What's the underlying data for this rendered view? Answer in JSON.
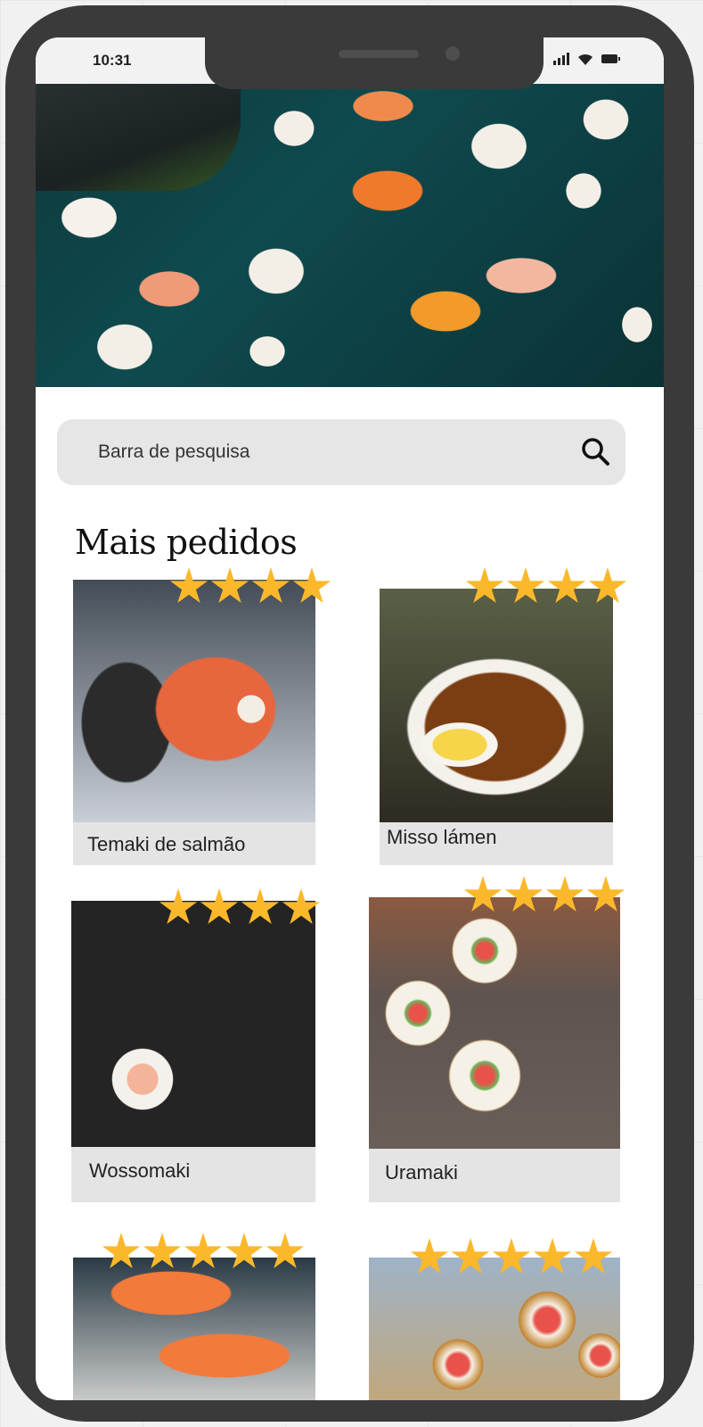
{
  "status_bar": {
    "time": "10:31"
  },
  "search": {
    "placeholder": "Barra de pesquisa",
    "icon": "search-icon"
  },
  "section": {
    "title": "Mais pedidos"
  },
  "items": [
    {
      "label": "Temaki de salmão",
      "rating": 4,
      "max_rating": 4
    },
    {
      "label": "Misso lámen",
      "rating": 4,
      "max_rating": 4
    },
    {
      "label": "Wossomaki",
      "rating": 4,
      "max_rating": 4
    },
    {
      "label": "Uramaki",
      "rating": 4,
      "max_rating": 4
    },
    {
      "label": "",
      "rating": 5,
      "max_rating": 5
    },
    {
      "label": "",
      "rating": 5,
      "max_rating": 5
    }
  ],
  "colors": {
    "star": "#fbb82b",
    "frame": "#3a3a3a",
    "card_bg": "#e4e4e4",
    "search_bg": "#e6e6e6"
  }
}
